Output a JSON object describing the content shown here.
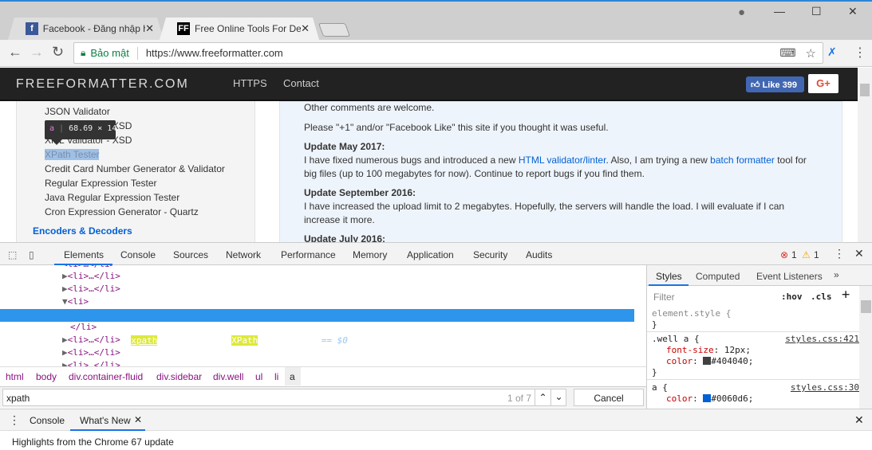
{
  "browser": {
    "tabs": [
      {
        "label": "Facebook - Đăng nhập hoặc",
        "favicon": "f",
        "close": "✕"
      },
      {
        "label": "Free Online Tools For Developers",
        "favicon": "FF",
        "close": "✕"
      }
    ],
    "security_label": "Bảo mật",
    "url": "https://www.freeformatter.com",
    "icons": [
      "back-icon",
      "forward-icon",
      "reload-icon",
      "lock-icon",
      "translate-icon",
      "star-icon",
      "extension-icon",
      "menu-icon"
    ]
  },
  "site": {
    "brand": "FREEFORMATTER.COM",
    "nav": [
      "HTTPS",
      "Contact"
    ],
    "like_label": "Like 399",
    "gplus": "G+",
    "sidebar": [
      "JSON Validator",
      "XML Validator - XSD",
      "XPath Tester",
      "Credit Card Number Generator & Validator",
      "Regular Expression Tester",
      "Java Regular Expression Tester",
      "Cron Expression Generator - Quartz"
    ],
    "sidebar_heading": "Encoders & Decoders",
    "tooltip": {
      "tag": "a",
      "size": "68.69 × 14"
    },
    "main": {
      "p1": "Other comments are welcome.",
      "p2": "Please \"+1\" and/or \"Facebook Like\" this site if you thought it was useful.",
      "h1": "Update May 2017:",
      "u1a": "I have fixed numerous bugs and introduced a new ",
      "u1link1": "HTML validator/linter",
      "u1b": ". Also, I am trying a new ",
      "u1link2": "batch formatter",
      "u1c": " tool for big files (up to 100 megabytes for now). Continue to report bugs if you find them.",
      "h2": "Update September 2016:",
      "u2": "I have increased the upload limit to 2 megabytes. Hopefully, the servers will handle the load. I will evaluate if I can increase it more.",
      "h3": "Update July 2016:"
    }
  },
  "devtools": {
    "tabs": [
      "Elements",
      "Console",
      "Sources",
      "Network",
      "Performance",
      "Memory",
      "Application",
      "Security",
      "Audits"
    ],
    "errors": "1",
    "warnings": "1",
    "dom": {
      "collapsed_li": "<li>…</li>",
      "open_li": "<li>",
      "close_li": "</li>",
      "a_open": "<a href=\"",
      "href_pre": "/",
      "href_hl": "xpath",
      "href_post": "-tester.html",
      "a_mid": "\">",
      "text_hl": "XPath",
      "text_rest": " Tester</a>",
      "eq": " == $0",
      "dots": "•••"
    },
    "breadcrumbs": [
      "html",
      "body",
      "div.container-fluid",
      "div.sidebar",
      "div.well",
      "ul",
      "li",
      "a"
    ],
    "search": {
      "value": "xpath",
      "count": "1 of 7",
      "cancel": "Cancel"
    },
    "styles": {
      "tabs": [
        "Styles",
        "Computed",
        "Event Listeners",
        "»"
      ],
      "filter_placeholder": "Filter",
      "hov": ":hov",
      "cls": ".cls",
      "plus": "+",
      "rules": [
        {
          "selector": "element.style {",
          "close": "}"
        },
        {
          "selector": ".well a {",
          "source": "styles.css:421",
          "props": [
            {
              "name": "font-size",
              "value": "12px;"
            },
            {
              "name": "color",
              "value": "#404040;",
              "swatch": "#404040"
            }
          ],
          "close": "}"
        },
        {
          "selector": "a {",
          "source": "styles.css:30",
          "props": [
            {
              "name": "color",
              "value": "#0060d6;",
              "swatch": "#0060d6"
            }
          ]
        }
      ]
    },
    "drawer": {
      "tabs": [
        "Console",
        "What's New"
      ],
      "close": "✕",
      "message": "Highlights from the Chrome 67 update"
    }
  }
}
